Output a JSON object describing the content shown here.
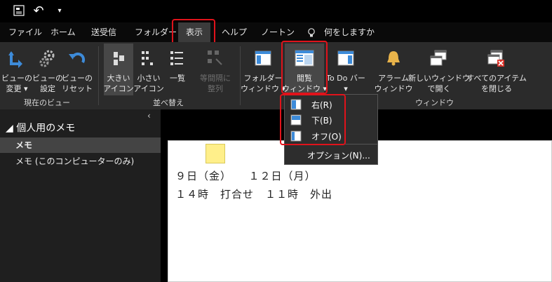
{
  "quick_access": {
    "undo": "↶"
  },
  "menu": {
    "tabs": [
      "ファイル",
      "ホーム",
      "送受信",
      "フォルダー",
      "表示",
      "ヘルプ",
      "ノートン"
    ],
    "tellme": "何をしますか"
  },
  "ribbon": {
    "current_view": {
      "label": "現在のビュー",
      "change_view": [
        "ビューの",
        "変更"
      ],
      "view_settings": [
        "ビューの",
        "設定"
      ],
      "reset_view": [
        "ビューの",
        "リセット"
      ]
    },
    "arrange": {
      "label": "並べ替え",
      "large_icons": [
        "大きい",
        "アイコン"
      ],
      "small_icons": [
        "小さい",
        "アイコン"
      ],
      "list": "一覧",
      "line_up": [
        "等間隔に",
        "整列"
      ]
    },
    "window": {
      "label": "ウィンドウ",
      "folder_pane": [
        "フォルダー",
        "ウィンドウ"
      ],
      "reading_pane": [
        "閲覧",
        "ウィンドウ"
      ],
      "todo_bar": "To Do バー",
      "reminders": [
        "アラーム",
        "ウィンドウ"
      ],
      "new_window": [
        "新しいウィンドウ",
        "で開く"
      ],
      "close_all": [
        "すべてのアイテム",
        "を閉じる"
      ]
    }
  },
  "dropdown": {
    "right": "右(R)",
    "bottom": "下(B)",
    "off": "オフ(O)",
    "options": "オプション(N)..."
  },
  "nav": {
    "header": "◢ 個人用のメモ",
    "items": [
      "メモ",
      "メモ (このコンピューターのみ)"
    ]
  },
  "note": {
    "line1": "９日（金）　　１２日（月）",
    "line2": "１４時　打合せ　１１時　外出"
  }
}
